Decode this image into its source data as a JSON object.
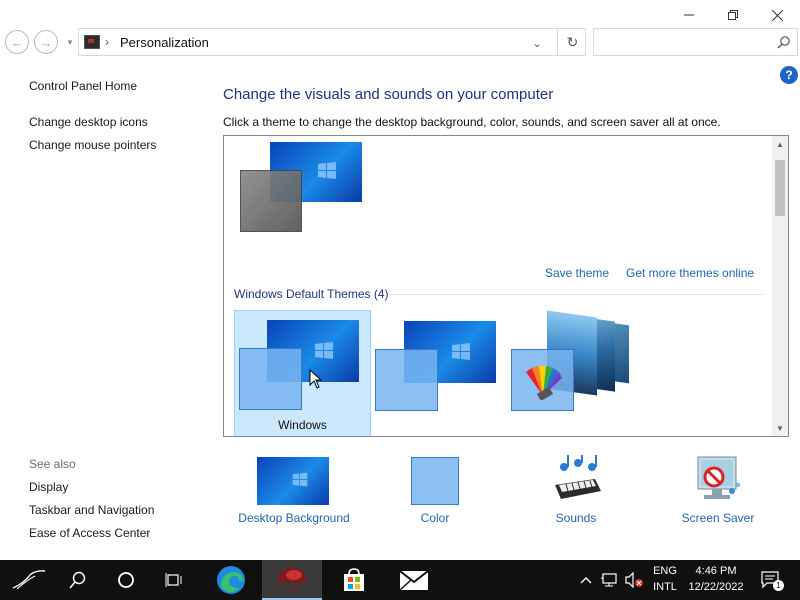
{
  "window": {
    "min_icon": "minimize-icon",
    "max_icon": "restore-icon",
    "close_icon": "close-icon"
  },
  "address": {
    "separator": "›",
    "path": "Personalization",
    "search_placeholder": ""
  },
  "sidebar": {
    "links": [
      "Control Panel Home",
      "Change desktop icons",
      "Change mouse pointers"
    ],
    "see_also_label": "See also",
    "see_also": [
      "Display",
      "Taskbar and Navigation",
      "Ease of Access Center"
    ]
  },
  "main": {
    "heading": "Change the visuals and sounds on your computer",
    "subtext": "Click a theme to change the desktop background, color, sounds, and screen saver all at once.",
    "save_theme": "Save theme",
    "get_more": "Get more themes online",
    "group_label": "Windows Default Themes (4)",
    "selected_theme": "Windows"
  },
  "options": [
    {
      "label": "Desktop Background",
      "icon": "desktop-background-icon"
    },
    {
      "label": "Color",
      "icon": "color-icon"
    },
    {
      "label": "Sounds",
      "icon": "sounds-icon"
    },
    {
      "label": "Screen Saver",
      "icon": "screen-saver-icon"
    }
  ],
  "taskbar": {
    "lang_top": "ENG",
    "lang_bottom": "INTL",
    "time": "4:46 PM",
    "date": "12/22/2022",
    "notification_count": "1"
  },
  "colors": {
    "accent": "#1e64b4",
    "heading": "#1e3287",
    "selection": "#cce8ff",
    "taskbar": "#101010"
  }
}
